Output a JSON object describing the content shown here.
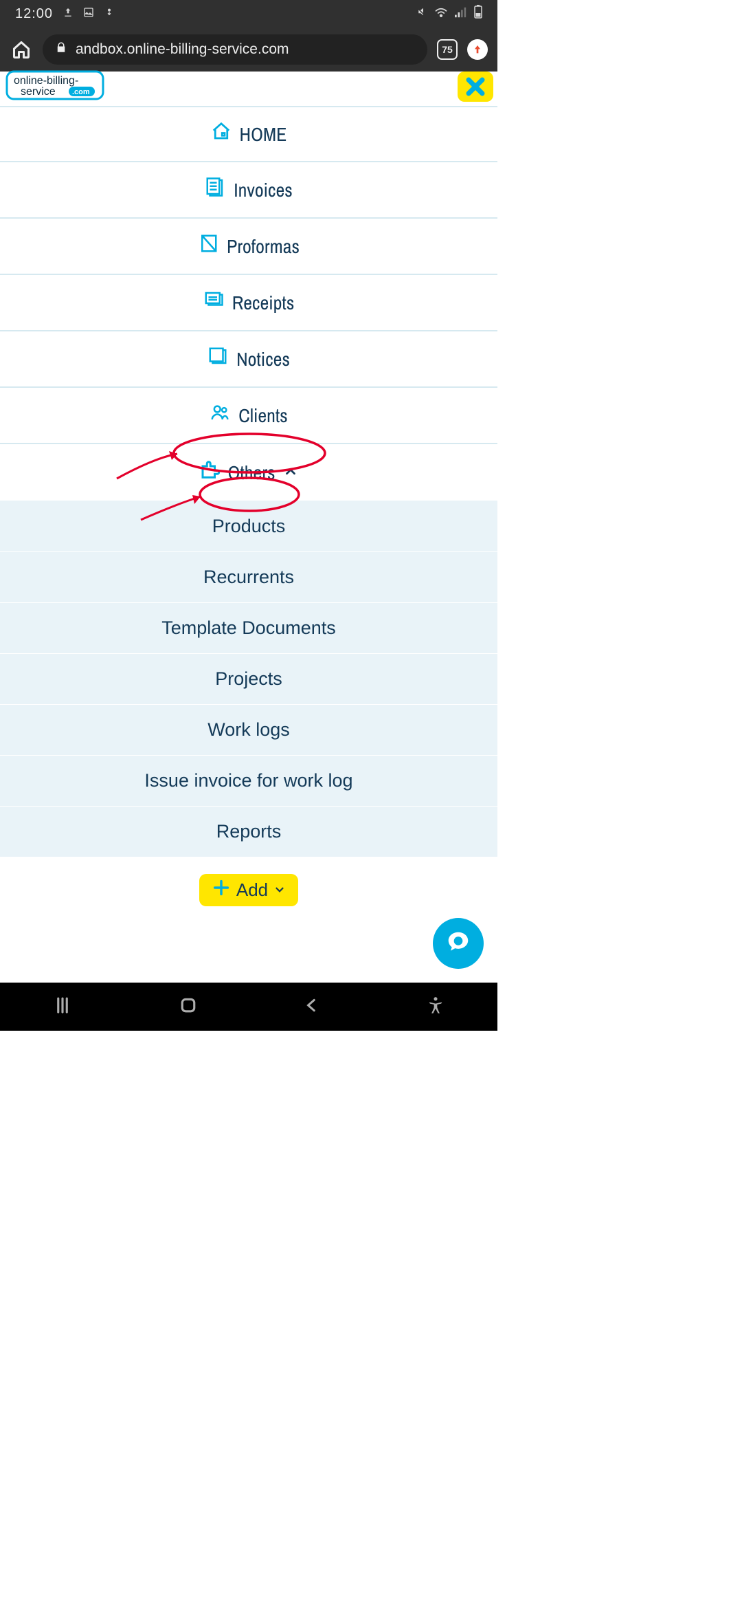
{
  "status_bar": {
    "time": "12:00"
  },
  "browser": {
    "url": "andbox.online-billing-service.com",
    "tab_count": "75"
  },
  "logo": {
    "line1": "online-billing-",
    "line2": "service",
    "badge": ".com"
  },
  "menu": {
    "items": [
      {
        "label": "HOME"
      },
      {
        "label": "Invoices"
      },
      {
        "label": "Proformas"
      },
      {
        "label": "Receipts"
      },
      {
        "label": "Notices"
      },
      {
        "label": "Clients"
      },
      {
        "label": "Others"
      }
    ],
    "others_sub": [
      {
        "label": "Products"
      },
      {
        "label": "Recurrents"
      },
      {
        "label": "Template Documents"
      },
      {
        "label": "Projects"
      },
      {
        "label": "Work logs"
      },
      {
        "label": "Issue invoice for work log"
      },
      {
        "label": "Reports"
      }
    ]
  },
  "add_button": {
    "label": "Add"
  }
}
